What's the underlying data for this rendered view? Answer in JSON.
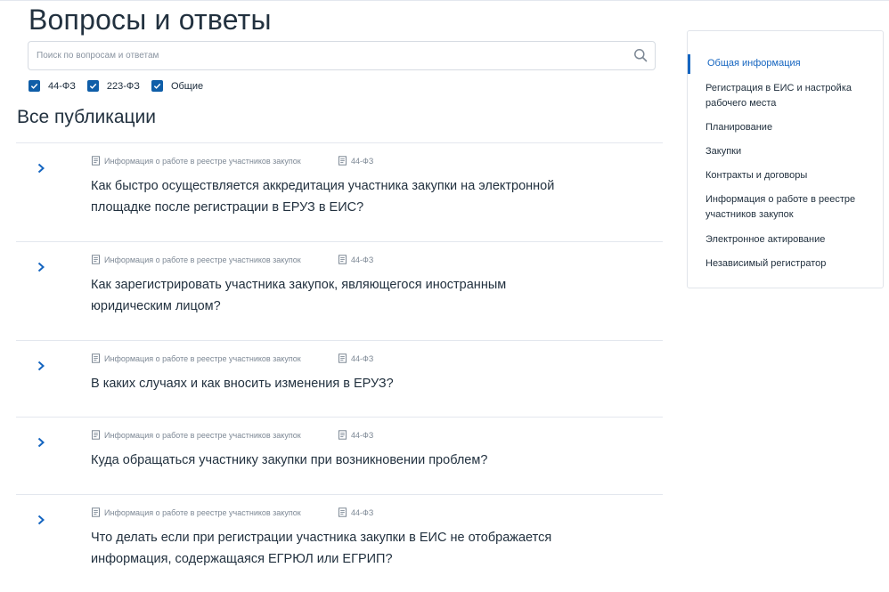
{
  "header": {
    "title": "Вопросы и ответы"
  },
  "search": {
    "placeholder": "Поиск по вопросам и ответам"
  },
  "filters": [
    {
      "label": "44-ФЗ",
      "checked": true
    },
    {
      "label": "223-ФЗ",
      "checked": true
    },
    {
      "label": "Общие",
      "checked": true
    }
  ],
  "section": {
    "title": "Все публикации"
  },
  "publications": [
    {
      "category": "Информация о работе в реестре участников закупок",
      "law": "44-ФЗ",
      "question": "Как быстро осуществляется аккредитация участника закупки на электронной площадке после регистрации в ЕРУЗ в ЕИС?"
    },
    {
      "category": "Информация о работе в реестре участников закупок",
      "law": "44-ФЗ",
      "question": "Как зарегистрировать участника закупок, являющегося иностранным юридическим лицом?"
    },
    {
      "category": "Информация о работе в реестре участников закупок",
      "law": "44-ФЗ",
      "question": "В каких случаях и как вносить изменения в ЕРУЗ?"
    },
    {
      "category": "Информация о работе в реестре участников закупок",
      "law": "44-ФЗ",
      "question": "Куда обращаться участнику закупки при возникновении проблем?"
    },
    {
      "category": "Информация о работе в реестре участников закупок",
      "law": "44-ФЗ",
      "question": "Что делать если при регистрации участника закупки в ЕИС не отображается информация, содержащаяся ЕГРЮЛ или ЕГРИП?"
    }
  ],
  "sidebar": {
    "items": [
      {
        "label": "Общая информация",
        "active": true
      },
      {
        "label": "Регистрация в ЕИС и настройка рабочего места",
        "active": false
      },
      {
        "label": "Планирование",
        "active": false
      },
      {
        "label": "Закупки",
        "active": false
      },
      {
        "label": "Контракты и договоры",
        "active": false
      },
      {
        "label": "Информация о работе в реестре участников закупок",
        "active": false
      },
      {
        "label": "Электронное актирование",
        "active": false
      },
      {
        "label": "Независимый регистратор",
        "active": false
      }
    ]
  },
  "colors": {
    "accent": "#1565c0",
    "checkbox": "#0f5ea8",
    "text": "#22313f",
    "meta": "#7d8895",
    "divider": "#e3e7ee"
  },
  "icons": {
    "search": "search-icon",
    "chevron": "chevron-right-icon",
    "document": "document-icon",
    "check": "check-icon"
  }
}
